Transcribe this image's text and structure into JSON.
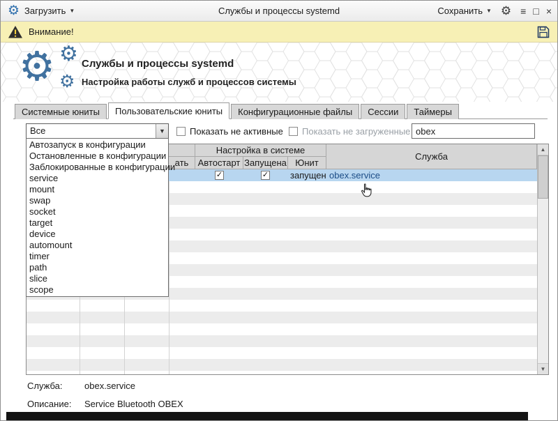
{
  "titlebar": {
    "load_label": "Загрузить",
    "title": "Службы и процессы systemd",
    "save_label": "Сохранить",
    "window_buttons": [
      "≡",
      "□",
      "×"
    ]
  },
  "warning_bar": {
    "text": "Внимание!"
  },
  "hero": {
    "title": "Службы и процессы systemd",
    "subtitle": "Настройка работы служб и процессов системы"
  },
  "tabs": [
    {
      "label": "Системные юниты",
      "active": false
    },
    {
      "label": "Пользовательские юниты",
      "active": true
    },
    {
      "label": "Конфигурационные файлы",
      "active": false
    },
    {
      "label": "Сессии",
      "active": false
    },
    {
      "label": "Таймеры",
      "active": false
    }
  ],
  "filters": {
    "type_filter_value": "Все",
    "type_filter_options": [
      "Автозапуск в конфигурации",
      "Остановленные в конфигурации",
      "Заблокированные в конфигурации",
      "service",
      "mount",
      "swap",
      "socket",
      "target",
      "device",
      "automount",
      "timer",
      "path",
      "slice",
      "scope"
    ],
    "show_inactive_label": "Показать не активные",
    "show_inactive_checked": false,
    "show_unloaded_label": "Показать не загруженные",
    "show_unloaded_checked": false,
    "search_value": "obex"
  },
  "table": {
    "group_header_system": "Настройка в системе",
    "partial_column_header": "ать",
    "columns": {
      "autostart": "Автостарт",
      "running": "Запущена",
      "unit": "Юнит",
      "service": "Служба"
    },
    "selected_row": {
      "autostart_checked": true,
      "running_checked": true,
      "unit_state": "запущен",
      "service_name": "obex.service"
    }
  },
  "details": {
    "service_label": "Служба:",
    "service_value": "obex.service",
    "description_label": "Описание:",
    "description_value": "Service Bluetooth OBEX"
  },
  "icons": {
    "gear": "⚙",
    "caret_down": "▼",
    "check": "✓",
    "scroll_up": "▲",
    "scroll_down": "▼"
  },
  "colors": {
    "accent_blue": "#2f6fad",
    "selection": "#b8d6f0",
    "warning_bg": "#f7f0b5",
    "link": "#1b4c86"
  }
}
